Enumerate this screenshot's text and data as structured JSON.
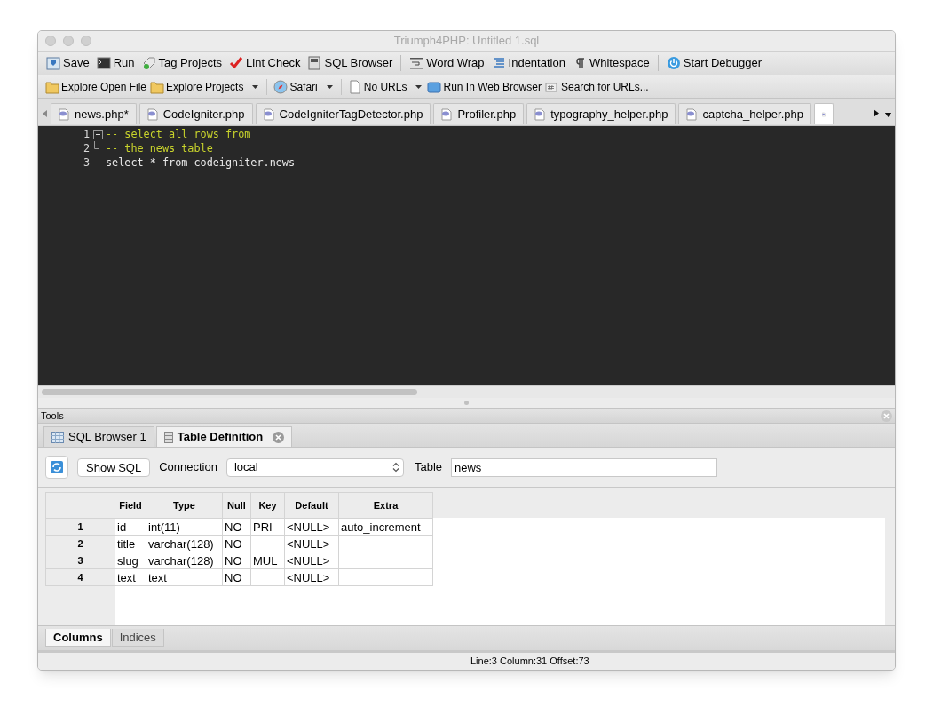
{
  "window": {
    "title": "Triumph4PHP: Untitled 1.sql"
  },
  "toolbar": [
    {
      "kind": "button",
      "label": "Save"
    },
    {
      "kind": "button",
      "label": "Run"
    },
    {
      "kind": "button",
      "label": "Tag Projects"
    },
    {
      "kind": "button",
      "label": "Lint Check"
    },
    {
      "kind": "button",
      "label": "SQL Browser"
    },
    {
      "kind": "separator"
    },
    {
      "kind": "button",
      "label": "Word Wrap"
    },
    {
      "kind": "button",
      "label": "Indentation"
    },
    {
      "kind": "button",
      "label": "Whitespace"
    },
    {
      "kind": "separator"
    },
    {
      "kind": "button",
      "label": "Start Debugger"
    }
  ],
  "toolbar_2": [
    {
      "kind": "button",
      "label": "Explore Open File",
      "dropdown": false
    },
    {
      "kind": "button",
      "label": "Explore Projects",
      "dropdown": true
    },
    {
      "kind": "separator"
    },
    {
      "kind": "button",
      "label": "Safari",
      "dropdown": true
    },
    {
      "kind": "separator"
    },
    {
      "kind": "button",
      "label": "No URLs",
      "dropdown": true
    },
    {
      "kind": "button",
      "label": "Run In Web Browser",
      "dropdown": false
    },
    {
      "kind": "button",
      "label": "Search for URLs...",
      "dropdown": false
    }
  ],
  "file_tabs": [
    {
      "label": "news.php*",
      "selected": false
    },
    {
      "label": "CodeIgniter.php",
      "selected": false
    },
    {
      "label": "CodeIgniterTagDetector.php",
      "selected": false
    },
    {
      "label": "Profiler.php",
      "selected": false
    },
    {
      "label": "typography_helper.php",
      "selected": false
    },
    {
      "label": "captcha_helper.php",
      "selected": false
    },
    {
      "selected": true
    }
  ],
  "editor": {
    "lines": [
      {
        "number": "1",
        "text": "-- select all rows from",
        "kind": "comment",
        "fold_start": true,
        "fold_end": false
      },
      {
        "number": "2",
        "text": "-- the news table",
        "kind": "comment",
        "fold_start": false,
        "fold_end": true
      },
      {
        "number": "3",
        "text": "select * from codeigniter.news",
        "kind": "code",
        "fold_start": false,
        "fold_end": false
      }
    ]
  },
  "tools": {
    "title": "Tools",
    "tabs": [
      {
        "label": "SQL Browser 1",
        "selected": false,
        "closable": false
      },
      {
        "label": "Table Definition",
        "selected": true,
        "closable": true
      }
    ],
    "show_sql_button": "Show SQL",
    "connection_label": "Connection",
    "connection_value": "local",
    "table_label": "Table",
    "table_value": "news",
    "table": {
      "columns": [
        "Field",
        "Type",
        "Null",
        "Key",
        "Default",
        "Extra"
      ],
      "rows": [
        {
          "number": "1",
          "cells": [
            "id",
            "int(11)",
            "NO",
            "PRI",
            "<NULL>",
            "auto_increment"
          ]
        },
        {
          "number": "2",
          "cells": [
            "title",
            "varchar(128)",
            "NO",
            "",
            "<NULL>",
            ""
          ]
        },
        {
          "number": "3",
          "cells": [
            "slug",
            "varchar(128)",
            "NO",
            "MUL",
            "<NULL>",
            ""
          ]
        },
        {
          "number": "4",
          "cells": [
            "text",
            "text",
            "NO",
            "",
            "<NULL>",
            ""
          ]
        }
      ]
    },
    "bottom_tabs": [
      {
        "label": "Columns",
        "selected": true
      },
      {
        "label": "Indices",
        "selected": false
      }
    ]
  },
  "status_bar": "Line:3 Column:31 Offset:73"
}
